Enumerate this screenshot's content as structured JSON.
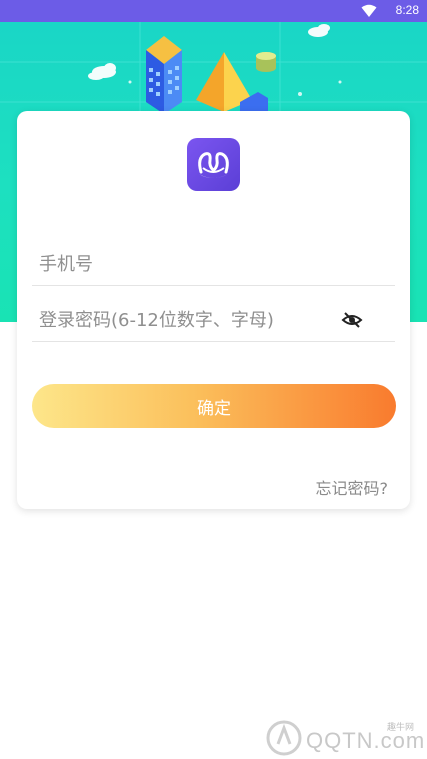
{
  "status_bar": {
    "time": "8:28",
    "wifi_icon": "wifi-icon"
  },
  "colors": {
    "status_bar": "#6c5ce7",
    "hero_bg": "#1ad6c6",
    "button_start": "#fde68a",
    "button_end": "#f97b2e",
    "logo_bg": "#6b4ae6"
  },
  "app": {
    "logo_icon": "swan-logo-icon"
  },
  "form": {
    "phone_placeholder": "手机号",
    "password_placeholder": "登录密码(6-12位数字、字母)",
    "toggle_icon": "eye-hidden-icon",
    "submit_label": "确定",
    "forgot_label": "忘记密码?"
  },
  "watermark": {
    "small_text": "趣牛网",
    "big_text": "QQTN.com"
  }
}
